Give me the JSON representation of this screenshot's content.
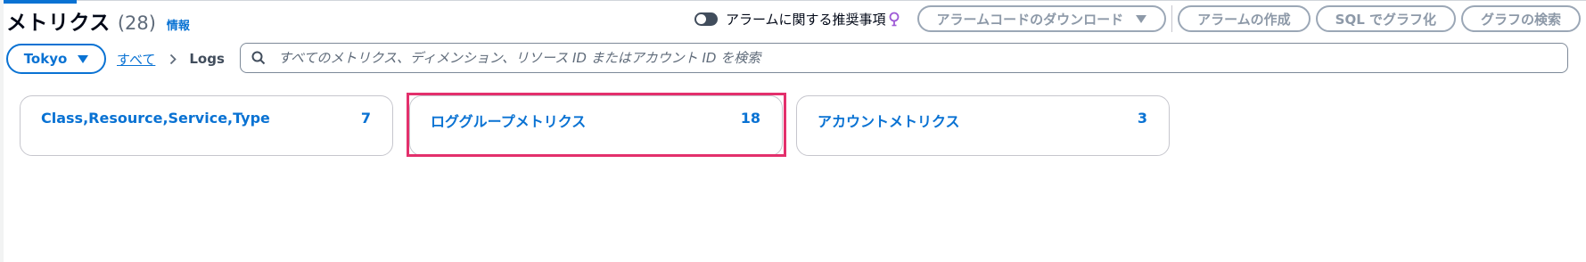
{
  "header": {
    "title": "メトリクス",
    "count": "(28)",
    "info_label": "情報"
  },
  "actions": {
    "toggle_label": "アラームに関する推奨事項",
    "download_button": "アラームコードのダウンロード",
    "create_alarm_button": "アラームの作成",
    "sql_graph_button": "SQL でグラフ化",
    "search_graph_button": "グラフの検索"
  },
  "region": {
    "label": "Tokyo"
  },
  "breadcrumb": {
    "all_label": "すべて",
    "current_label": "Logs"
  },
  "search": {
    "placeholder": "すべてのメトリクス、ディメンション、リソース ID またはアカウント ID を検索"
  },
  "cards": [
    {
      "label": "Class,Resource,Service,Type",
      "count": "7"
    },
    {
      "label": "ロググループメトリクス",
      "count": "18"
    },
    {
      "label": "アカウントメトリクス",
      "count": "3"
    }
  ],
  "colors": {
    "link_blue": "#0972d3",
    "highlight": "#e3306c",
    "toggle_off": "#414d5c"
  },
  "icons": {
    "toggle": "toggle-off-icon",
    "bulb": "lightbulb-icon",
    "caret": "caret-down-icon",
    "chevron": "chevron-right-icon",
    "search": "search-icon"
  }
}
